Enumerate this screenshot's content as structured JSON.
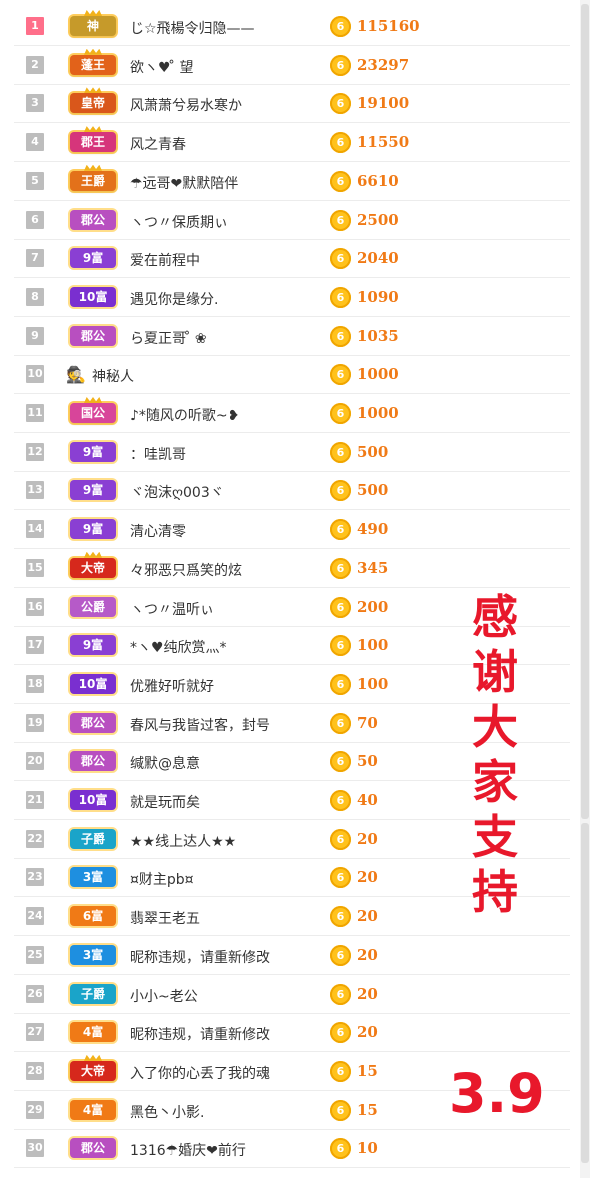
{
  "rows": [
    {
      "rank": "1",
      "badge": "神",
      "badge_color": "#c69a2a",
      "name": "じ☆飛楊令归隐——",
      "score": "115160"
    },
    {
      "rank": "2",
      "badge": "蓬王",
      "badge_color": "#e2621a",
      "name": "欲ヽ♥ ̊ 望",
      "score": "23297"
    },
    {
      "rank": "3",
      "badge": "皇帝",
      "badge_color": "#d9571b",
      "name": "风萧萧兮易水寒か",
      "score": "19100"
    },
    {
      "rank": "4",
      "badge": "郡王",
      "badge_color": "#d6357b",
      "name": "风之青春",
      "score": "11550"
    },
    {
      "rank": "5",
      "badge": "王爵",
      "badge_color": "#e3711a",
      "name": "☂远哥❤默默陪伴",
      "score": "6610"
    },
    {
      "rank": "6",
      "badge": "郡公",
      "badge_color": "#b84fc0",
      "name": "ヽつ〃保质期ぃ",
      "score": "2500"
    },
    {
      "rank": "7",
      "badge": "9富",
      "badge_color": "#8a3fd3",
      "name": "爱在前程中",
      "score": "2040"
    },
    {
      "rank": "8",
      "badge": "10富",
      "badge_color": "#7a2fd0",
      "name": "遇见你是缘分.",
      "score": "1090"
    },
    {
      "rank": "9",
      "badge": "郡公",
      "badge_color": "#b84fc0",
      "name": "ら夏正哥 ̊ ❀",
      "score": "1035"
    },
    {
      "rank": "10",
      "badge": "",
      "badge_color": "",
      "name": "神秘人",
      "score": "1000"
    },
    {
      "rank": "11",
      "badge": "国公",
      "badge_color": "#d8459a",
      "name": "♪*随风の听歌~❥",
      "score": "1000"
    },
    {
      "rank": "12",
      "badge": "9富",
      "badge_color": "#8a3fd3",
      "name": "：哇凯哥",
      "score": "500"
    },
    {
      "rank": "13",
      "badge": "9富",
      "badge_color": "#8a3fd3",
      "name": "ヾ泡沫ღ003ヾ",
      "score": "500"
    },
    {
      "rank": "14",
      "badge": "9富",
      "badge_color": "#8a3fd3",
      "name": "清心清零",
      "score": "490"
    },
    {
      "rank": "15",
      "badge": "大帝",
      "badge_color": "#d6281c",
      "name": "々邪恶只爲笑的炫",
      "score": "345"
    },
    {
      "rank": "16",
      "badge": "公爵",
      "badge_color": "#b65ac8",
      "name": "ヽつ〃温听ぃ",
      "score": "200"
    },
    {
      "rank": "17",
      "badge": "9富",
      "badge_color": "#8a3fd3",
      "name": "*ヽ♥纯欣赏灬*",
      "score": "100"
    },
    {
      "rank": "18",
      "badge": "10富",
      "badge_color": "#7a2fd0",
      "name": "优雅好听就好",
      "score": "100"
    },
    {
      "rank": "19",
      "badge": "郡公",
      "badge_color": "#b84fc0",
      "name": "春风与我皆过客，封号",
      "score": "70"
    },
    {
      "rank": "20",
      "badge": "郡公",
      "badge_color": "#b84fc0",
      "name": "缄默@息意",
      "score": "50"
    },
    {
      "rank": "21",
      "badge": "10富",
      "badge_color": "#7a2fd0",
      "name": "就是玩而矣",
      "score": "40"
    },
    {
      "rank": "22",
      "badge": "子爵",
      "badge_color": "#1aa4c9",
      "name": "★★线上达人★★",
      "score": "20"
    },
    {
      "rank": "23",
      "badge": "3富",
      "badge_color": "#1e8fe0",
      "name": "¤财主pb¤",
      "score": "20"
    },
    {
      "rank": "24",
      "badge": "6富",
      "badge_color": "#f07a16",
      "name": "翡翠王老五",
      "score": "20"
    },
    {
      "rank": "25",
      "badge": "3富",
      "badge_color": "#1e8fe0",
      "name": "昵称违规，请重新修改",
      "score": "20"
    },
    {
      "rank": "26",
      "badge": "子爵",
      "badge_color": "#1aa4c9",
      "name": "小小~老公",
      "score": "20"
    },
    {
      "rank": "27",
      "badge": "4富",
      "badge_color": "#f07a16",
      "name": "昵称违规，请重新修改",
      "score": "20"
    },
    {
      "rank": "28",
      "badge": "大帝",
      "badge_color": "#d6281c",
      "name": "入了你的心丢了我的魂",
      "score": "15"
    },
    {
      "rank": "29",
      "badge": "4富",
      "badge_color": "#f07a16",
      "name": "黑色丶小影.",
      "score": "15"
    },
    {
      "rank": "30",
      "badge": "郡公",
      "badge_color": "#b84fc0",
      "name": "1316☂婚庆❤前行",
      "score": "10"
    }
  ],
  "coin_glyph": "6",
  "spy_icon": "🕵",
  "overlay": {
    "chars": [
      "感",
      "谢",
      "大",
      "家",
      "支",
      "持"
    ],
    "version": "3.9"
  },
  "colors": {
    "accent_red": "#e8182b",
    "score_orange": "#f07a16",
    "coin_gold": "#ffc21c"
  }
}
